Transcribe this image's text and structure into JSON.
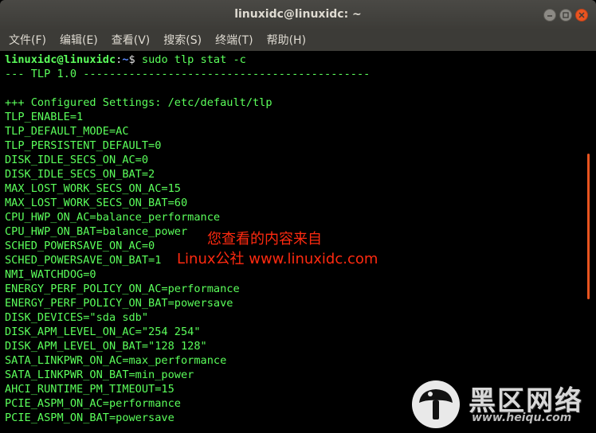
{
  "window": {
    "title": "linuxidc@linuxidc: ~",
    "buttons": [
      "minimize",
      "maximize",
      "close"
    ]
  },
  "menubar": {
    "items": [
      {
        "label": "文件(F)"
      },
      {
        "label": "编辑(E)"
      },
      {
        "label": "查看(V)"
      },
      {
        "label": "搜索(S)"
      },
      {
        "label": "终端(T)"
      },
      {
        "label": "帮助(H)"
      }
    ]
  },
  "terminal": {
    "prompt": {
      "user": "linuxidc@linuxidc",
      "sep": ":",
      "path": "~",
      "dollar": "$ ",
      "command": "sudo tlp stat -c"
    },
    "lines": [
      "--- TLP 1.0 --------------------------------------------",
      "",
      "+++ Configured Settings: /etc/default/tlp",
      "TLP_ENABLE=1",
      "TLP_DEFAULT_MODE=AC",
      "TLP_PERSISTENT_DEFAULT=0",
      "DISK_IDLE_SECS_ON_AC=0",
      "DISK_IDLE_SECS_ON_BAT=2",
      "MAX_LOST_WORK_SECS_ON_AC=15",
      "MAX_LOST_WORK_SECS_ON_BAT=60",
      "CPU_HWP_ON_AC=balance_performance",
      "CPU_HWP_ON_BAT=balance_power",
      "SCHED_POWERSAVE_ON_AC=0",
      "SCHED_POWERSAVE_ON_BAT=1",
      "NMI_WATCHDOG=0",
      "ENERGY_PERF_POLICY_ON_AC=performance",
      "ENERGY_PERF_POLICY_ON_BAT=powersave",
      "DISK_DEVICES=\"sda sdb\"",
      "DISK_APM_LEVEL_ON_AC=\"254 254\"",
      "DISK_APM_LEVEL_ON_BAT=\"128 128\"",
      "SATA_LINKPWR_ON_AC=max_performance",
      "SATA_LINKPWR_ON_BAT=min_power",
      "AHCI_RUNTIME_PM_TIMEOUT=15",
      "PCIE_ASPM_ON_AC=performance",
      "PCIE_ASPM_ON_BAT=powersave"
    ]
  },
  "watermark": {
    "line1": "您查看的内容来自",
    "line2": "Linux公社 www.linuxidc.com",
    "logo_cn": "黑区网络",
    "logo_url": "www.heiqu.com"
  },
  "colors": {
    "terminal_text": "#5bff5b",
    "path": "#5b8cff",
    "accent": "#e95420",
    "watermark": "#ff2a10"
  }
}
